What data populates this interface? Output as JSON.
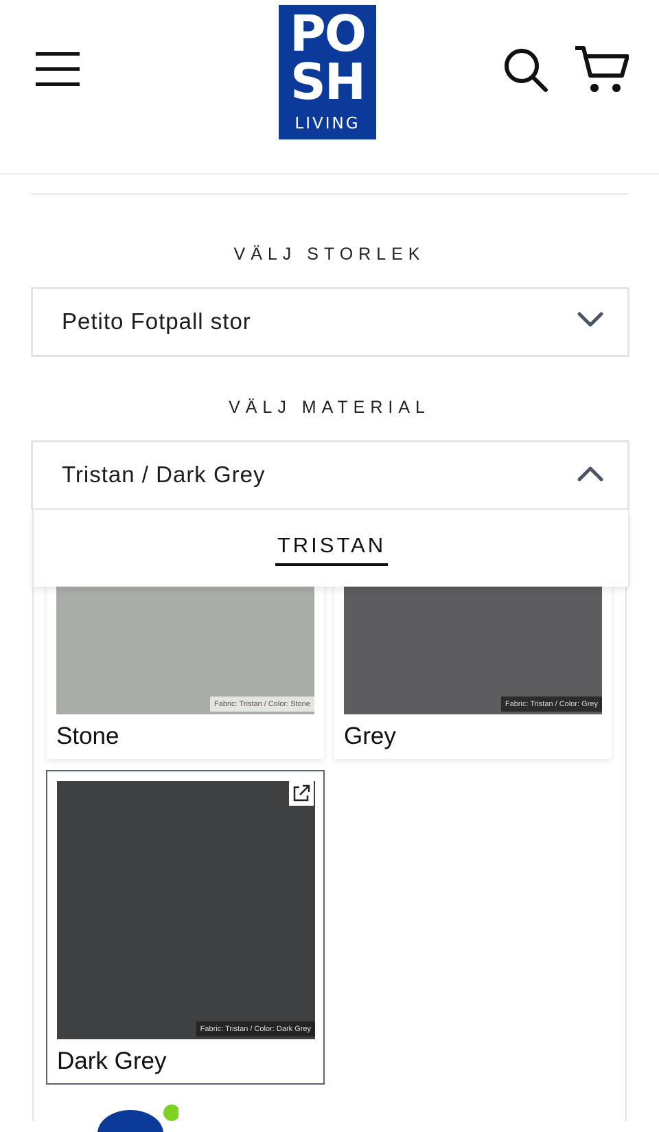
{
  "header": {
    "logo": {
      "line1": "PO",
      "line2": "SH",
      "line3": "LIVING"
    },
    "menu_icon": "hamburger-icon",
    "search_icon": "search-icon",
    "cart_icon": "cart-icon"
  },
  "size": {
    "label": "VÄLJ STORLEK",
    "selected": "Petito Fotpall stor",
    "state": "collapsed"
  },
  "material": {
    "label": "VÄLJ MATERIAL",
    "selected": "Tristan / Dark Grey",
    "state": "expanded",
    "tabs": [
      {
        "label": "TRISTAN",
        "active": true
      }
    ],
    "swatches": [
      {
        "name": "Stone",
        "tag": "Fabric: Tristan / Color: Stone",
        "color": "#a9ada8"
      },
      {
        "name": "Grey",
        "tag": "Fabric: Tristan / Color: Grey",
        "color": "#5d5d5f"
      },
      {
        "name": "Dark Grey",
        "tag": "Fabric: Tristan / Color: Dark Grey",
        "color": "#3f4042",
        "selected": true
      }
    ]
  },
  "colors": {
    "brand": "#0b3a9b",
    "selected_border": "#5b6675",
    "divider": "#ecebe4"
  }
}
